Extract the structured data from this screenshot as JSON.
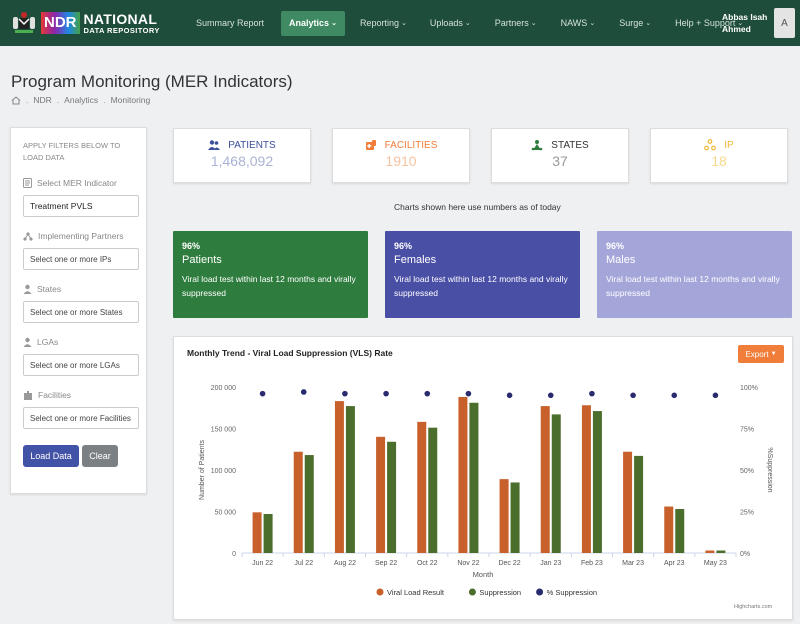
{
  "brand": {
    "badge": "NDR",
    "title": "NATIONAL",
    "subtitle": "DATA REPOSITORY"
  },
  "nav": [
    {
      "label": "Summary Report",
      "caret": false,
      "active": false
    },
    {
      "label": "Analytics",
      "caret": true,
      "active": true
    },
    {
      "label": "Reporting",
      "caret": true,
      "active": false
    },
    {
      "label": "Uploads",
      "caret": true,
      "active": false
    },
    {
      "label": "Partners",
      "caret": true,
      "active": false
    },
    {
      "label": "NAWS",
      "caret": true,
      "active": false
    },
    {
      "label": "Surge",
      "caret": true,
      "active": false
    },
    {
      "label": "Help + Support",
      "caret": true,
      "active": false
    }
  ],
  "user": {
    "line1": "Abbas Isah",
    "line2": "Ahmed",
    "avatar": "A"
  },
  "page": {
    "title": "Program Monitoring (MER Indicators)",
    "breadcrumb": [
      "NDR",
      "Analytics",
      "Monitoring"
    ]
  },
  "filters": {
    "heading": "APPLY FILTERS BELOW TO LOAD DATA",
    "mer_label": "Select MER Indicator",
    "mer_value": "Treatment PVLS",
    "ip_label": "Implementing Partners",
    "ip_placeholder": "Select one or more IPs",
    "states_label": "States",
    "states_placeholder": "Select one or more States",
    "lga_label": "LGAs",
    "lga_placeholder": "Select one or more LGAs",
    "facilities_label": "Facilities",
    "facilities_placeholder": "Select one or more Facilities",
    "load_button": "Load Data",
    "clear_button": "Clear"
  },
  "stats": [
    {
      "label": "PATIENTS",
      "value": "1,468,092",
      "label_color": "#3b4f9c",
      "value_color": "#aab3d4",
      "icon": "patients-icon"
    },
    {
      "label": "FACILITIES",
      "value": "1910",
      "label_color": "#f07e3a",
      "value_color": "#f6c3a2",
      "icon": "facilities-icon"
    },
    {
      "label": "STATES",
      "value": "37",
      "label_color": "#333333",
      "value_color": "#999999",
      "icon": "states-icon"
    },
    {
      "label": "IP",
      "value": "18",
      "label_color": "#f0b93a",
      "value_color": "#f5d98e",
      "icon": "ip-icon"
    }
  ],
  "as_of_note": "Charts shown here use numbers as of today",
  "vls_cards": [
    {
      "pct": "96%",
      "label": "Patients",
      "desc": "Viral load test within last 12 months and virally suppressed",
      "color": "#2f7d3e"
    },
    {
      "pct": "96%",
      "label": "Females",
      "desc": "Viral load test within last 12 months and virally suppressed",
      "color": "#4a4fa6"
    },
    {
      "pct": "96%",
      "label": "Males",
      "desc": "Viral load test within last 12 months and virally suppressed",
      "color": "#a4a6d9"
    }
  ],
  "chart": {
    "title": "Monthly Trend - Viral Load Suppression (VLS) Rate",
    "export_label": "Export",
    "credit": "Highcharts.com"
  },
  "chart_data": {
    "type": "bar",
    "title": "Monthly Trend - Viral Load Suppression (VLS) Rate",
    "xlabel": "Month",
    "ylabel": "Number of Patients",
    "y2label": "%Suppression",
    "ylim": [
      0,
      200000
    ],
    "y2lim": [
      0,
      100
    ],
    "yticks": [
      "0",
      "50 000",
      "100 000",
      "150 000",
      "200 000"
    ],
    "y2ticks": [
      "0%",
      "25%",
      "50%",
      "75%",
      "100%"
    ],
    "categories": [
      "Jun 22",
      "Jul 22",
      "Aug 22",
      "Sep 22",
      "Oct 22",
      "Nov 22",
      "Dec 22",
      "Jan 23",
      "Feb 23",
      "Mar 23",
      "Apr 23",
      "May 23"
    ],
    "series": [
      {
        "name": "Viral Load Result",
        "kind": "bar",
        "color": "#c8602c",
        "values": [
          49000,
          122000,
          183000,
          140000,
          158000,
          188000,
          89000,
          177000,
          178000,
          122000,
          56000,
          3000
        ]
      },
      {
        "name": "Suppression",
        "kind": "bar",
        "color": "#4c6e2d",
        "values": [
          47000,
          118000,
          177000,
          134000,
          151000,
          181000,
          85000,
          167000,
          171000,
          117000,
          53000,
          3000
        ]
      },
      {
        "name": "% Suppression",
        "kind": "scatter",
        "color": "#2a2a6e",
        "axis": "right",
        "values": [
          96,
          97,
          96,
          96,
          96,
          96,
          95,
          95,
          96,
          95,
          95,
          95
        ]
      }
    ],
    "legend": "bottom-center",
    "grid": false
  }
}
